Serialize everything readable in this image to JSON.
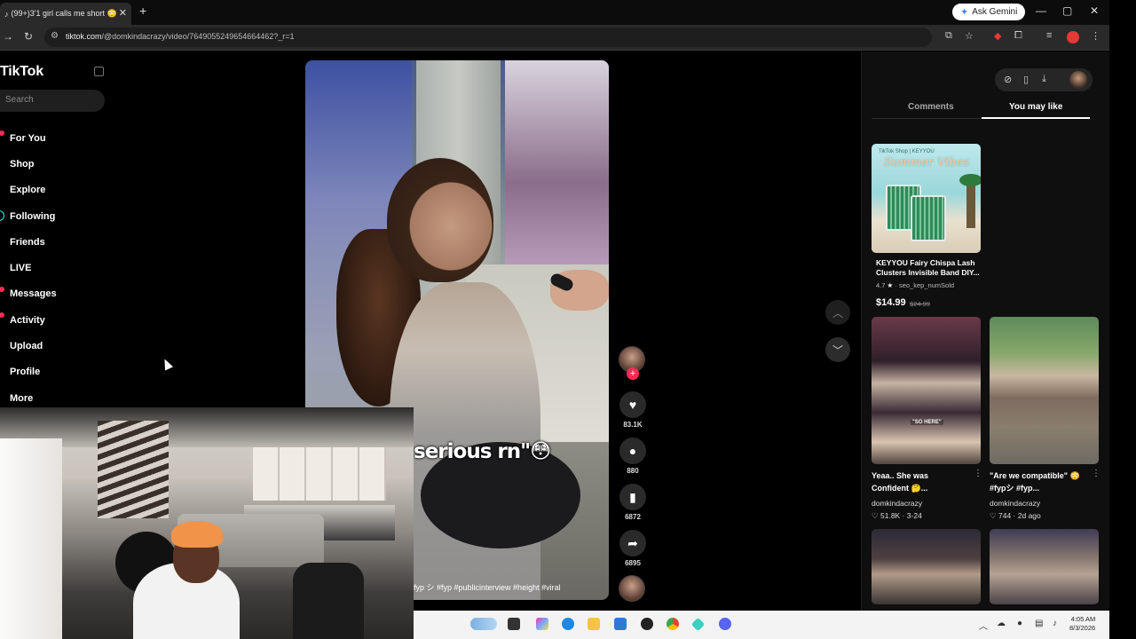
{
  "browser": {
    "tab_title": "(99+)3'1 girl calls me short 😳",
    "tab_close": "✕",
    "new_tab": "+",
    "ask_gemini": "Ask Gemini",
    "url_domain": "tiktok.com",
    "url_path": "/@domkindacrazy/video/7649055249654664462?_r=1",
    "window_controls": [
      "—",
      "▢",
      "✕"
    ]
  },
  "sidebar": {
    "logo": "TikTok",
    "search_placeholder": "Search",
    "items": [
      {
        "label": "For You"
      },
      {
        "label": "Shop"
      },
      {
        "label": "Explore"
      },
      {
        "label": "Following"
      },
      {
        "label": "Friends"
      },
      {
        "label": "LIVE"
      },
      {
        "label": "Messages"
      },
      {
        "label": "Activity"
      },
      {
        "label": "Upload"
      },
      {
        "label": "Profile"
      },
      {
        "label": "More"
      }
    ]
  },
  "video": {
    "caption_overlay": "serious rn\"😳",
    "hashtags": "fyp シ #fyp #publicinterview #height #viral"
  },
  "actions": {
    "likes": "83.1K",
    "comments": "880",
    "saves": "6872",
    "shares": "6895"
  },
  "right_panel": {
    "tabs": [
      "Comments",
      "You may like"
    ],
    "active_tab": "You may like",
    "product": {
      "banner_brand": "TikTok Shop | KEYYOU",
      "banner_text": "Summer Vibes",
      "title": "KEYYOU Fairy Chispa Lash Clusters Invisible Band DIY...",
      "rating": "4.7",
      "sold_text": "seo_kep_numSold",
      "price": "$14.99",
      "old_price": "$24.99"
    },
    "videos": [
      {
        "title": "Yeaa.. She was Confident 🤔...",
        "author": "domkindacrazy",
        "likes": "51.8K",
        "date": "3-24",
        "overlay": "\"SO HERE\""
      },
      {
        "title": "\"Are we compatible\" 😳 #fypシ #fyp...",
        "author": "domkindacrazy",
        "likes": "744",
        "date": "2d ago"
      }
    ]
  },
  "taskbar": {
    "time": "4:05 AM",
    "date": "8/3/2026"
  },
  "colors": {
    "accent_pink": "#fe2c55",
    "accent_cyan": "#25f4ee",
    "background": "#000000"
  }
}
